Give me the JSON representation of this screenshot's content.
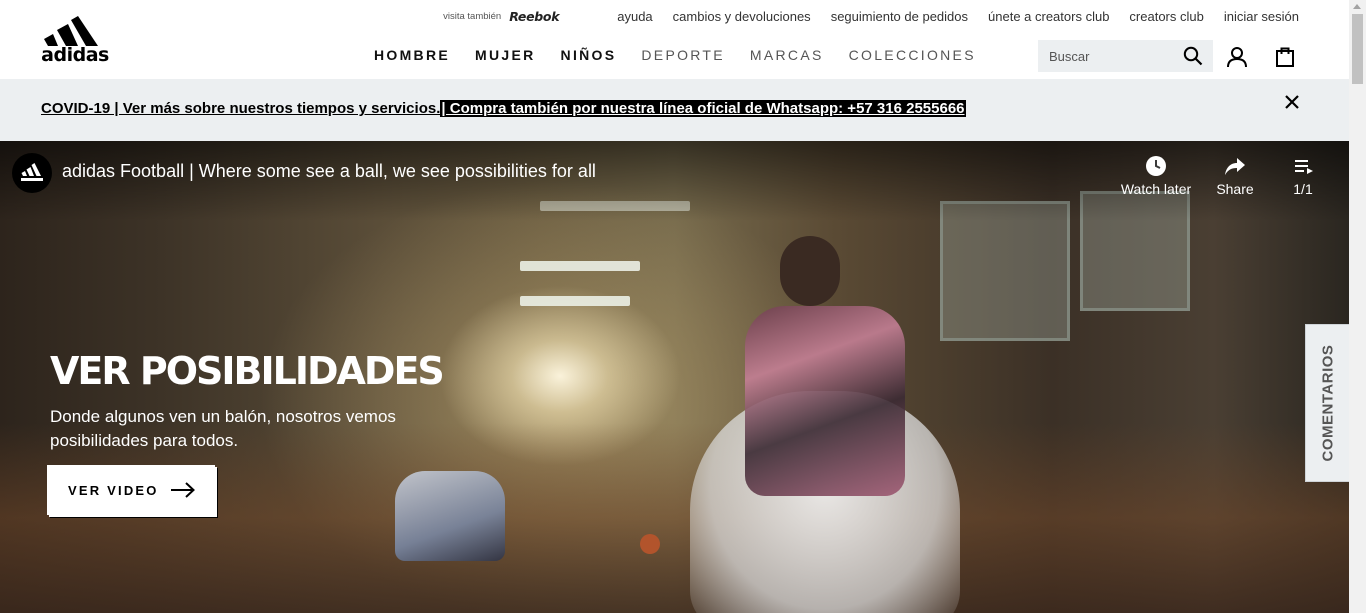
{
  "header": {
    "logo_text": "adidas",
    "util_links": {
      "visit_also": "visita también",
      "reebok": "Reebok",
      "help": "ayuda",
      "returns": "cambios y devoluciones",
      "order_tracking": "seguimiento de pedidos",
      "join_creators": "únete a creators club",
      "creators_club": "creators club",
      "login": "iniciar sesión"
    },
    "nav": [
      "HOMBRE",
      "MUJER",
      "NIÑOS",
      "DEPORTE",
      "MARCAS",
      "COLECCIONES"
    ],
    "search_placeholder": "Buscar"
  },
  "banner": {
    "text_a": "COVID-19 | Ver más sobre nuestros tiempos y servicios.",
    "text_b": "| Compra también por nuestra línea oficial de Whatsapp: +57 316 2555666"
  },
  "video": {
    "title": "adidas Football | Where some see a ball, we see possibilities for all",
    "watch_later": "Watch later",
    "share": "Share",
    "playlist": "1/1"
  },
  "hero": {
    "title": "VER POSIBILIDADES",
    "subtitle": "Donde algunos ven un balón, nosotros vemos posibilidades para todos.",
    "cta": "VER VIDEO"
  },
  "feedback_tab": "COMENTARIOS",
  "colors": {
    "accent": "#000000",
    "banner_bg": "#eceff1",
    "search_bg": "#eceff1"
  }
}
